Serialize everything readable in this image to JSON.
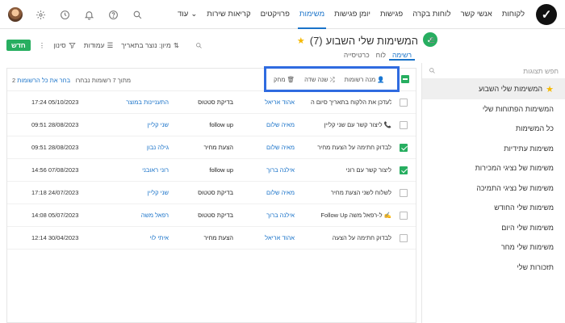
{
  "nav": {
    "items": [
      "לקוחות",
      "אנשי קשר",
      "לוחות בקרה",
      "פגישות",
      "יומן פגישות",
      "משימות",
      "פרויקטים",
      "קריאות שירות"
    ],
    "active_index": 5,
    "more_label": "עוד"
  },
  "topicons": [
    "search-icon",
    "help-icon",
    "bell-icon",
    "clock-icon",
    "gear-icon",
    "avatar"
  ],
  "page": {
    "title": "המשימות שלי השבוע",
    "count": "(7)",
    "view_tabs": [
      "רשימה",
      "לוח",
      "כרטיסייה"
    ],
    "active_view": 0
  },
  "toolbar": {
    "new_label": "חדש",
    "filter_label": "סינון",
    "columns_label": "עמודות",
    "sort_label": "מיון: נוצר בתאריך"
  },
  "sidebar": {
    "search_placeholder": "חפש תצוגות",
    "items": [
      {
        "label": "המשימות שלי השבוע",
        "starred": true,
        "active": true
      },
      {
        "label": "המשימות הפתוחות שלי",
        "starred": false,
        "active": false
      },
      {
        "label": "כל המשימות",
        "starred": false,
        "active": false
      },
      {
        "label": "משימות עתידיות",
        "starred": false,
        "active": false
      },
      {
        "label": "משימות של נציגי המכירות",
        "starred": false,
        "active": false
      },
      {
        "label": "משימות של נציגי התמיכה",
        "starred": false,
        "active": false
      },
      {
        "label": "משימות שלי החודש",
        "starred": false,
        "active": false
      },
      {
        "label": "משימות שלי היום",
        "starred": false,
        "active": false
      },
      {
        "label": "משימות שלי מחר",
        "starred": false,
        "active": false
      },
      {
        "label": "תזכורות שלי",
        "starred": false,
        "active": false
      }
    ]
  },
  "bulk": {
    "selection_text": "2 מתוך 7 רשומות נבחרו",
    "select_all_label": "בחר את כל הרשומות",
    "change_owner": "מנה רשומות",
    "change_field": "שנה שדה",
    "delete": "מחק"
  },
  "rows": [
    {
      "checked": false,
      "title": "לעדכן את הלקוח בתאריך סיום ה...",
      "assignee": "אהוד אריאל",
      "status": "בדיקת סטטוס",
      "contact": "התעניינות במוצר",
      "date": "17:24 05/10/2023"
    },
    {
      "checked": false,
      "title": "ליצור קשר עם שני קליין 📞",
      "assignee": "מאיה שלום",
      "status": "follow up",
      "contact": "שני קליין",
      "date": "09:51 28/08/2023"
    },
    {
      "checked": true,
      "title": "לבדוק חתימה על הצעת מחיר",
      "assignee": "מאיה שלום",
      "status": "הצעת מחיר",
      "contact": "גילה נבון",
      "date": "09:51 28/08/2023"
    },
    {
      "checked": true,
      "title": "ליצור קשר עם רוני",
      "assignee": "אילנה ברוך",
      "status": "follow up",
      "contact": "רוני ראובני",
      "date": "14:56 07/08/2023"
    },
    {
      "checked": false,
      "title": "לשלוח לשני הצעת מחיר",
      "assignee": "מאיה שלום",
      "status": "בדיקת סטטוס",
      "contact": "שני קליין",
      "date": "17:18 24/07/2023"
    },
    {
      "checked": false,
      "title": "Follow Up ל-רפאל משה ✍️",
      "assignee": "אילנה ברוך",
      "status": "בדיקת סטטוס",
      "contact": "רפאל משה",
      "date": "14:08 05/07/2023"
    },
    {
      "checked": false,
      "title": "לבדוק חתימה על הצעה",
      "assignee": "אהוד אריאל",
      "status": "הצעת מחיר",
      "contact": "איתי לוי",
      "date": "12:14 30/04/2023"
    }
  ]
}
